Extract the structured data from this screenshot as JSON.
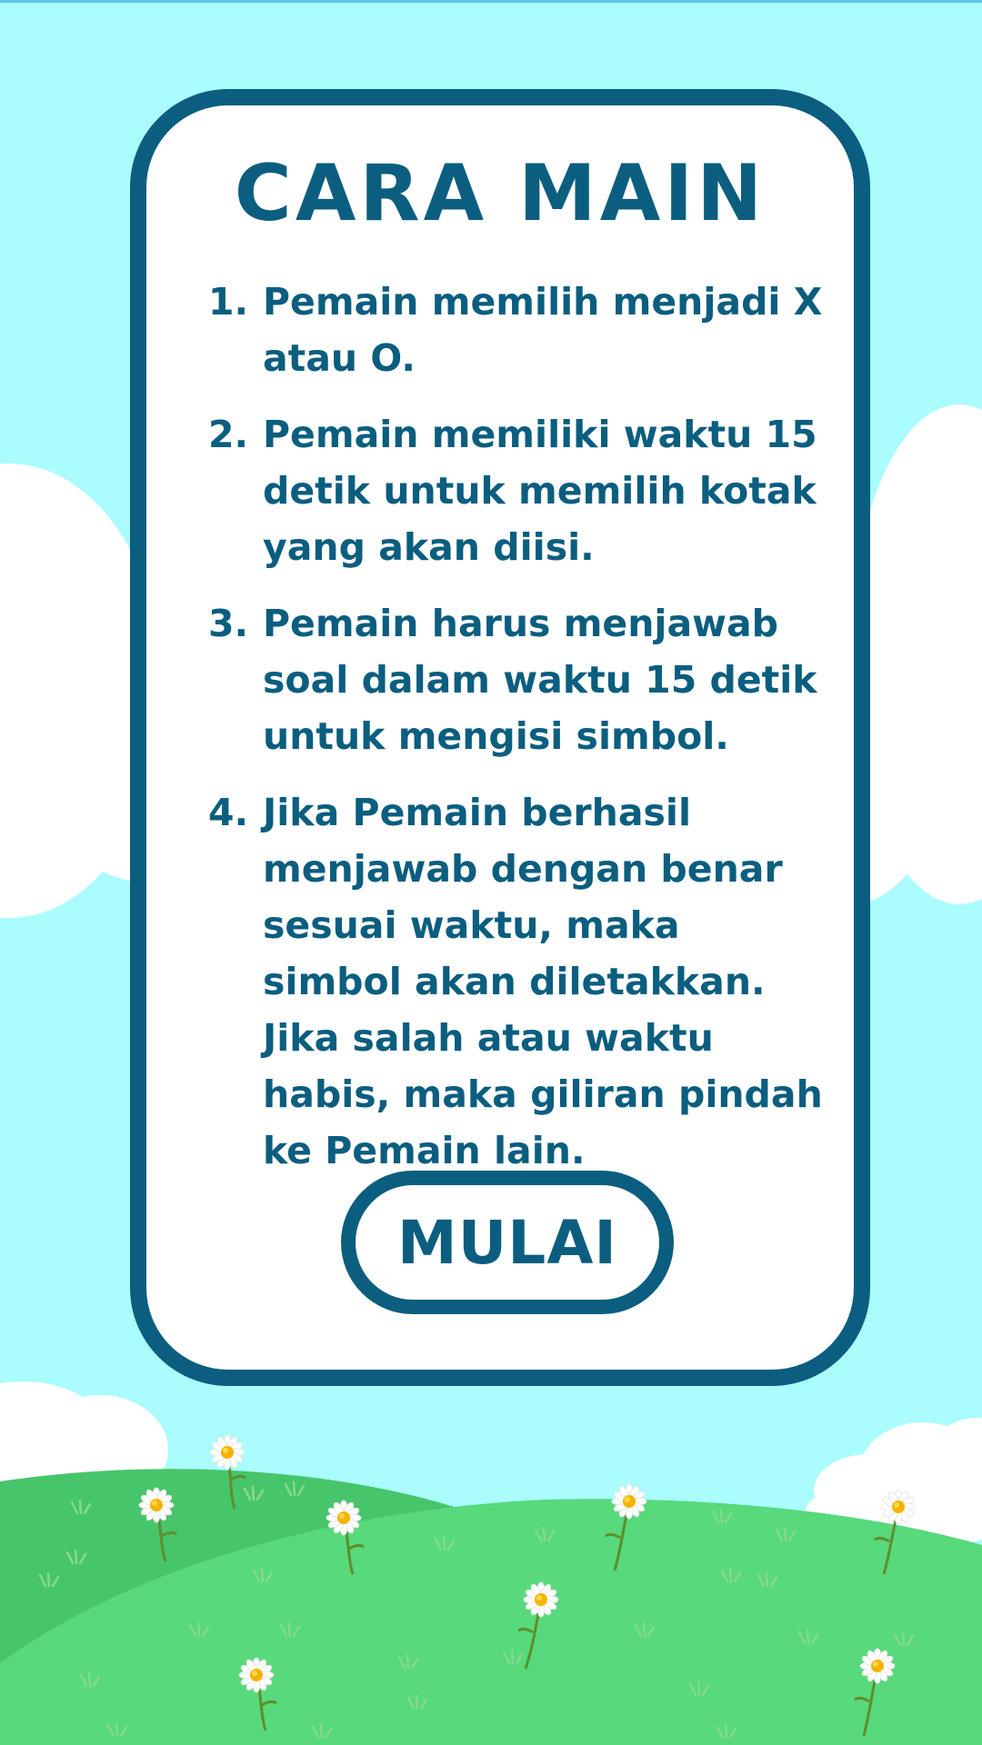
{
  "page": {
    "title": "CARA MAIN",
    "rules": [
      {
        "number": "1.",
        "text": "Pemain memilih menjadi X atau O."
      },
      {
        "number": "2.",
        "text": "Pemain memiliki waktu 15 detik untuk memilih kotak yang akan diisi."
      },
      {
        "number": "3.",
        "text": "Pemain harus menjawab soal dalam waktu 15 detik untuk mengisi simbol."
      },
      {
        "number": "4.",
        "text": "Jika Pemain berhasil menjawab dengan benar sesuai waktu, maka simbol akan diletakkan. Jika salah atau waktu habis, maka giliran pindah ke Pemain lain."
      }
    ],
    "start_button_label": "MULAI"
  },
  "colors": {
    "sky": "#aafcfd",
    "primary": "#0b5e7f",
    "card": "#ffffff",
    "cloud": "#ffffff",
    "hill_back": "#47c56b",
    "hill_front": "#57d97c",
    "grass_blade": "#7bd28a",
    "stem": "#5e8f2c",
    "petal": "#ffffff",
    "flower_center": "#f5b300"
  },
  "icons": {
    "cloud": "cloud-icon",
    "flower": "daisy-icon",
    "grass": "grass-tuft-icon"
  }
}
